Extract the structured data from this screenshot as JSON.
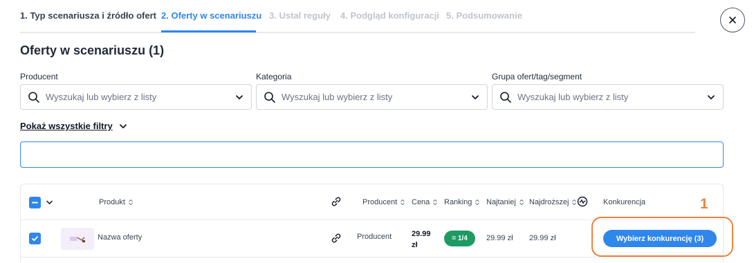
{
  "stepper": {
    "steps": [
      {
        "label": "1. Typ scenariusza i źródło ofert",
        "state": "done"
      },
      {
        "label": "2. Oferty w scenariuszu",
        "state": "active"
      },
      {
        "label": "3. Ustal reguły",
        "state": "pending"
      },
      {
        "label": "4. Podgląd konfiguracji",
        "state": "pending"
      },
      {
        "label": "5. Podsumowanie",
        "state": "pending"
      }
    ]
  },
  "close_icon": "close-icon",
  "page": {
    "title": "Oferty w scenariuszu (1)"
  },
  "filters": {
    "producer": {
      "label": "Producent",
      "placeholder": "Wyszukaj lub wybierz z listy"
    },
    "category": {
      "label": "Kategoria",
      "placeholder": "Wyszukaj lub wybierz z listy"
    },
    "group": {
      "label": "Grupa ofert/tag/segment",
      "placeholder": "Wyszukaj lub wybierz z listy"
    },
    "show_all": "Pokaż wszystkie filtry"
  },
  "search": {
    "value": ""
  },
  "table": {
    "headers": {
      "product": "Produkt",
      "producer": "Producent",
      "price": "Cena",
      "ranking": "Ranking",
      "cheapest": "Najtaniej",
      "most_expensive": "Najdroższej",
      "competition": "Konkurencja"
    },
    "rows": [
      {
        "name": "Nazwa oferty",
        "producer": "Producent",
        "price_line1": "29.99",
        "price_line2": "zł",
        "ranking": "= 1/4",
        "cheapest": "29.99 zł",
        "most_expensive": "29.99 zł",
        "action": "Wybierz konkurencję (3)",
        "checked": true
      }
    ]
  },
  "annotation": {
    "number": "1",
    "color": "#f0803c"
  },
  "colors": {
    "accent": "#2f86eb",
    "ranking_badge": "#1e9b63",
    "highlight": "#f0803c"
  }
}
